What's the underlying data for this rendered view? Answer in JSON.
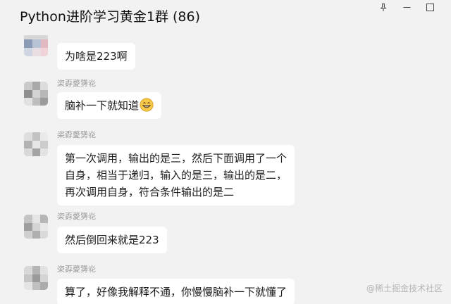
{
  "header": {
    "title": "Python进阶学习黄金1群 (86)"
  },
  "icons": {
    "pin": "pin-icon",
    "minimize": "minimize-icon",
    "maximize": "maximize-icon",
    "emoji": "grinning-face-icon"
  },
  "messages": [
    {
      "sender": "",
      "lines": [
        "为啥是223啊"
      ]
    },
    {
      "sender": "栥孬薆勥炛",
      "lines": [
        "脑补一下就知道"
      ],
      "emoji": "grinning-face-icon"
    },
    {
      "sender": "栥孬薆勥炛",
      "lines": [
        "第一次调用，输出的是三，然后下面调用了一个",
        "自身，相当于递归，输入的是三，输出的是二，",
        "再次调用自身，符合条件输出的是二"
      ]
    },
    {
      "sender": "栥孬薆勥炛",
      "lines": [
        "然后倒回来就是223"
      ]
    },
    {
      "sender": "栥孬薆勥炛",
      "lines": [
        "算了，好像我解释不通，你慢慢脑补一下就懂了"
      ]
    }
  ],
  "watermark": "@稀土掘金技术社区",
  "colors": {
    "background": "#f2f2f2",
    "bubble": "#ffffff",
    "sender_name": "#9a9a9a",
    "avatar_tile": "#c8c8c8"
  }
}
